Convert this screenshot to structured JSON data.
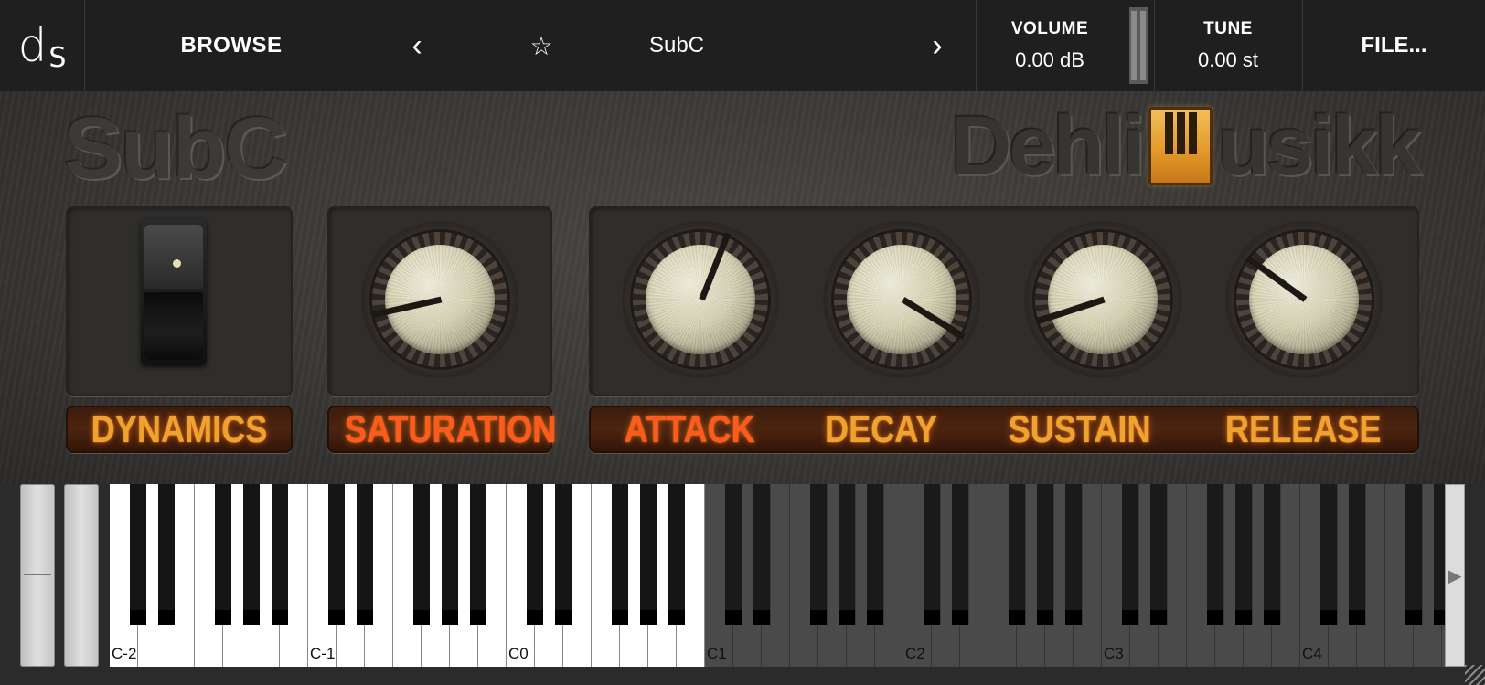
{
  "topbar": {
    "logo_d": "d",
    "logo_s": "S",
    "browse_label": "BROWSE",
    "prev_icon": "‹",
    "next_icon": "›",
    "star_icon": "☆",
    "preset_name": "SubC",
    "volume": {
      "label": "VOLUME",
      "value": "0.00 dB"
    },
    "tune": {
      "label": "TUNE",
      "value": "0.00 st"
    },
    "file_label": "FILE..."
  },
  "instrument": {
    "title": "SubC",
    "brand_left": "Dehli",
    "brand_right": "usikk",
    "controls": {
      "dynamics": {
        "label": "DYNAMICS",
        "switch_position": "up"
      },
      "saturation": {
        "label": "SATURATION",
        "value_fraction": 0.12
      },
      "attack": {
        "label": "ATTACK",
        "value_fraction": 0.58
      },
      "decay": {
        "label": "DECAY",
        "value_fraction": 0.95
      },
      "sustain": {
        "label": "SUSTAIN",
        "value_fraction": 0.1
      },
      "release": {
        "label": "RELEASE",
        "value_fraction": 0.3
      }
    }
  },
  "keyboard": {
    "note_labels": [
      "C-2",
      "C-1",
      "C0",
      "C1",
      "C2",
      "C3",
      "C4"
    ],
    "active_octaves": 3,
    "scroll_icon": "▶"
  },
  "colors": {
    "label_orange": "#f0a230",
    "label_red": "#ff5a1e",
    "topbar_bg": "#1f1f1f"
  }
}
